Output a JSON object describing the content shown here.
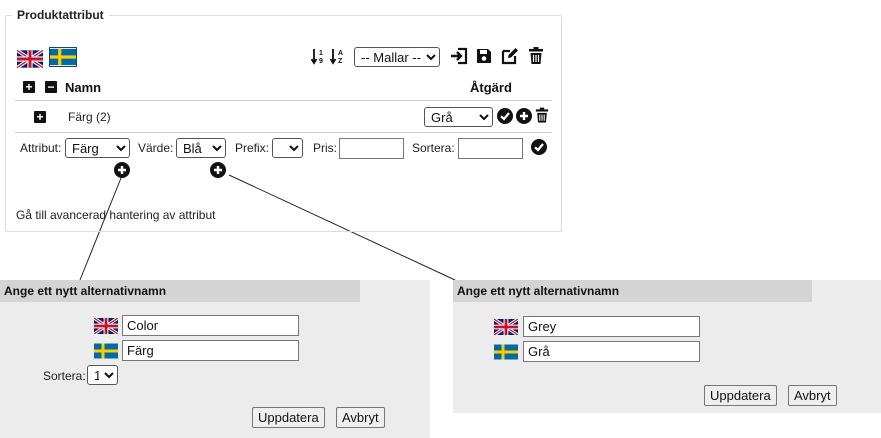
{
  "section": {
    "title": "Produktattribut",
    "templates_select": "-- Mallar --",
    "header_name": "Namn",
    "header_action": "Åtgärd",
    "advanced_link": "Gå till avancerad hantering av attribut"
  },
  "attribute_row": {
    "name": "Färg (2)",
    "value_select": "Grå"
  },
  "edit_row": {
    "attribute_label": "Attribut:",
    "attribute_value": "Färg",
    "value_label": "Värde:",
    "value_value": "Blå",
    "prefix_label": "Prefix:",
    "prefix_value": "",
    "price_label": "Pris:",
    "price_value": "",
    "sort_label": "Sortera:",
    "sort_value": ""
  },
  "panel_left": {
    "title": "Ange ett nytt alternativnamn",
    "english_value": "Color",
    "swedish_value": "Färg",
    "sort_label": "Sortera:",
    "sort_value": "1",
    "update_button": "Uppdatera",
    "cancel_button": "Avbryt"
  },
  "panel_right": {
    "title": "Ange ett nytt alternativnamn",
    "english_value": "Grey",
    "swedish_value": "Grå",
    "update_button": "Uppdatera",
    "cancel_button": "Avbryt"
  },
  "icons": {
    "flags": [
      "uk-flag-icon",
      "swedish-flag-icon"
    ],
    "toolbar": [
      "sort-numeric-icon",
      "sort-alpha-icon",
      "import-icon",
      "save-icon",
      "edit-icon",
      "trash-icon"
    ],
    "row_actions": [
      "check-icon",
      "plus-circle-icon",
      "trash-icon"
    ]
  }
}
